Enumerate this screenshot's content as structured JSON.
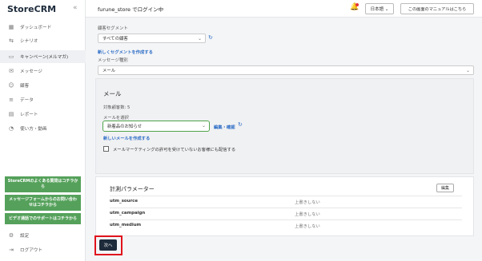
{
  "sidebar": {
    "brand": "StoreCRM",
    "collapse_glyph": "«",
    "items": [
      {
        "label": "ダッシュボード",
        "icon": "dashboard-icon",
        "glyph": "▦"
      },
      {
        "label": "シナリオ",
        "icon": "scenario-icon",
        "glyph": "⇆"
      },
      {
        "label": "キャンペーン(メルマガ)",
        "icon": "campaign-icon",
        "glyph": "▭",
        "active": true
      },
      {
        "label": "メッセージ",
        "icon": "message-icon",
        "glyph": "✉"
      },
      {
        "label": "顧客",
        "icon": "customers-icon",
        "glyph": "☺"
      },
      {
        "label": "データ",
        "icon": "data-icon",
        "glyph": "≡"
      },
      {
        "label": "レポート",
        "icon": "report-icon",
        "glyph": "▤"
      },
      {
        "label": "使い方・動画",
        "icon": "help-icon",
        "glyph": "◔"
      }
    ],
    "promo_faq": "StoreCRMのよくある質問はコチラから",
    "promo_contact": "メッセージフォームからのお問い合わせはコチラから",
    "promo_video": "ビデオ通話でのサポートはコチラから",
    "settings": {
      "label": "設定",
      "glyph": "⚙"
    },
    "logout": {
      "label": "ログアウト",
      "glyph": "⇥"
    }
  },
  "topbar": {
    "title": "furune_store でログイン中",
    "bell_glyph": "🔔",
    "language": "日本語 ⌄",
    "manual": "この画面のマニュアルはこちら"
  },
  "form": {
    "segment_label": "顧客セグメント",
    "segment_value": "すべての顧客",
    "new_segment_link": "新しくセグメントを作成する",
    "message_type_label": "メッセージ種別",
    "message_type_value": "メール",
    "chevron": "⌄",
    "refresh_glyph": "↻"
  },
  "mail": {
    "title": "メール",
    "target_count": "対象顧客数: 5",
    "select_label": "メールを選択",
    "select_value": "新着品のお知らせ",
    "edit_link": "編集・確認",
    "new_mail_link": "新しいメールを作成する",
    "checkbox_label": "メールマーケティングの許可を受けていないお客様にも配信する"
  },
  "params": {
    "title": "計測パラメーター",
    "edit_button": "編集",
    "rows": [
      {
        "key": "utm_source",
        "value": "上書きしない"
      },
      {
        "key": "utm_campaign",
        "value": "上書きしない"
      },
      {
        "key": "utm_medium",
        "value": "上書きしない"
      }
    ]
  },
  "next_button": "次へ",
  "colors": {
    "accent_green": "#55a15b",
    "link_blue": "#2c6cc6",
    "dark_button": "#1d2b3a",
    "highlight_red": "#e0131c"
  }
}
